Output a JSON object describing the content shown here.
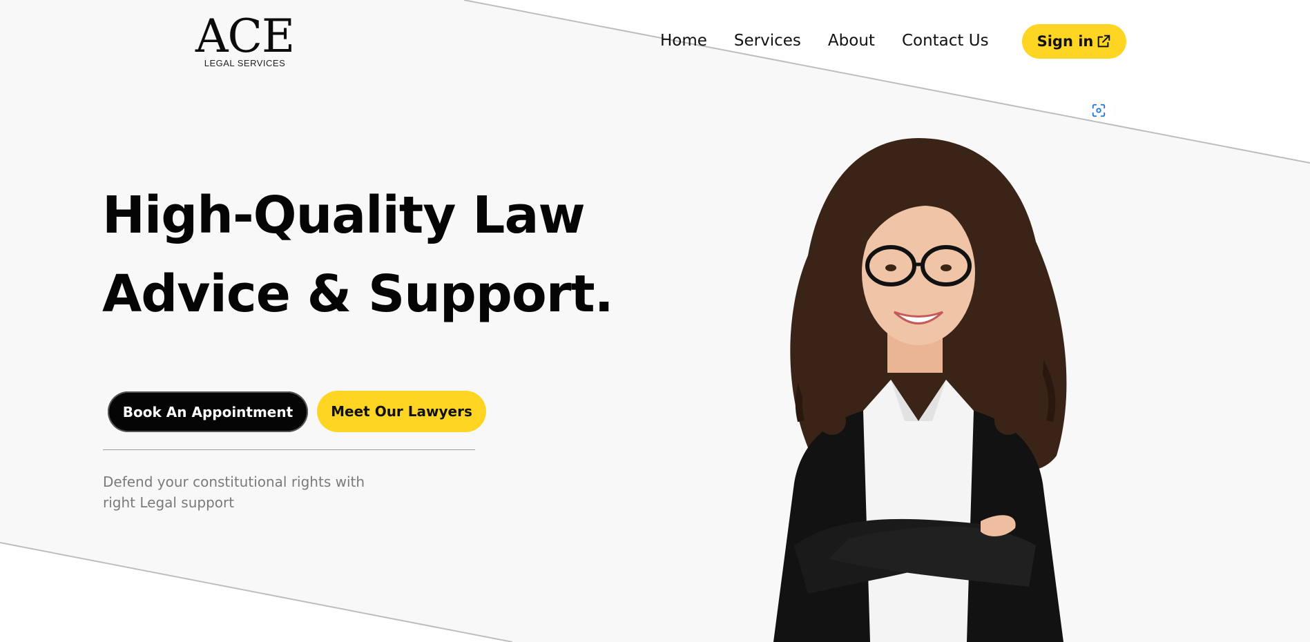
{
  "brand": {
    "name": "ACE",
    "tagline": "LEGAL SERVICES"
  },
  "nav": {
    "items": [
      "Home",
      "Services",
      "About",
      "Contact Us"
    ],
    "signin_label": "Sign in"
  },
  "hero": {
    "title_line1": "High-Quality Law",
    "title_line2": "Advice & Support.",
    "primary_cta": "Book An Appointment",
    "secondary_cta": "Meet Our Lawyers",
    "subtitle_line1": "Defend your constitutional rights with",
    "subtitle_line2": "right Legal support"
  },
  "colors": {
    "accent": "#fdd522",
    "dark": "#050505",
    "band": "#f8f8f8",
    "muted_text": "#7a7a7a"
  },
  "icons": {
    "signin": "external-link-icon",
    "scan": "focus-scan-icon"
  }
}
